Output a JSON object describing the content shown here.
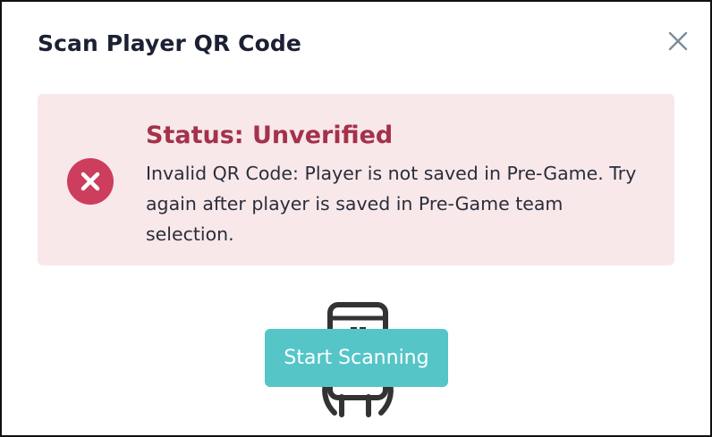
{
  "modal": {
    "title": "Scan Player QR Code",
    "close_icon": "close-icon"
  },
  "alert": {
    "status": "Status: Unverified",
    "message": "Invalid QR Code: Player is not saved in Pre-Game. Try again after player is saved in Pre-Game team selection.",
    "icon": "error-x-icon",
    "background_color": "#f8e8ea",
    "status_color": "#a3324a",
    "icon_color": "#cc3d5e"
  },
  "scanner": {
    "icon": "phone-scan-icon",
    "button_label": "Start Scanning",
    "button_color": "#55c5c8"
  }
}
